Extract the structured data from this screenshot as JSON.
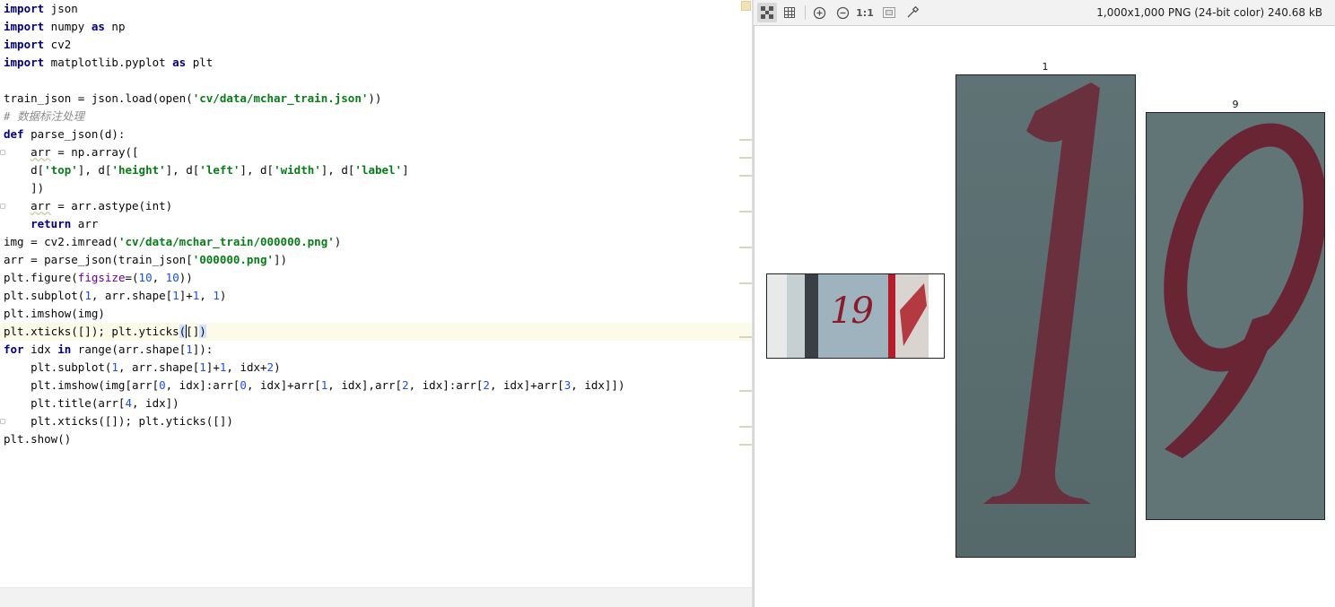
{
  "editor": {
    "lines": [
      [
        {
          "t": "import",
          "c": "kw"
        },
        {
          "t": " json"
        }
      ],
      [
        {
          "t": "import",
          "c": "kw"
        },
        {
          "t": " numpy "
        },
        {
          "t": "as",
          "c": "kw"
        },
        {
          "t": " np"
        }
      ],
      [
        {
          "t": "import",
          "c": "kw"
        },
        {
          "t": " cv2"
        }
      ],
      [
        {
          "t": "import",
          "c": "kw"
        },
        {
          "t": " matplotlib.pyplot "
        },
        {
          "t": "as",
          "c": "kw"
        },
        {
          "t": " plt"
        }
      ],
      [],
      [
        {
          "t": "train_json = json.load(open("
        },
        {
          "t": "'cv/data/mchar_train.json'",
          "c": "str"
        },
        {
          "t": "))"
        }
      ],
      [
        {
          "t": "# 数据标注处理",
          "c": "cmt"
        }
      ],
      [
        {
          "t": "def",
          "c": "kw"
        },
        {
          "t": " parse_json(d):"
        }
      ],
      [
        {
          "t": "    "
        },
        {
          "t": "arr",
          "c": "sq"
        },
        {
          "t": " = np.array(["
        }
      ],
      [
        {
          "t": "    d["
        },
        {
          "t": "'top'",
          "c": "str"
        },
        {
          "t": "], d["
        },
        {
          "t": "'height'",
          "c": "str"
        },
        {
          "t": "], d["
        },
        {
          "t": "'left'",
          "c": "str"
        },
        {
          "t": "], d["
        },
        {
          "t": "'width'",
          "c": "str"
        },
        {
          "t": "], d["
        },
        {
          "t": "'label'",
          "c": "str"
        },
        {
          "t": "]"
        }
      ],
      [
        {
          "t": "    ])"
        }
      ],
      [
        {
          "t": "    "
        },
        {
          "t": "arr",
          "c": "sq"
        },
        {
          "t": " = arr.astype(int)"
        }
      ],
      [
        {
          "t": "    "
        },
        {
          "t": "return",
          "c": "kw"
        },
        {
          "t": " arr"
        }
      ],
      [
        {
          "t": "img = cv2.imread("
        },
        {
          "t": "'cv/data/mchar_train/000000.png'",
          "c": "str"
        },
        {
          "t": ")"
        }
      ],
      [
        {
          "t": "arr = parse_json(train_json["
        },
        {
          "t": "'000000.png'",
          "c": "str"
        },
        {
          "t": "])"
        }
      ],
      [
        {
          "t": "plt.figure("
        },
        {
          "t": "figsize",
          "c": "kwarg"
        },
        {
          "t": "=("
        },
        {
          "t": "10",
          "c": "num"
        },
        {
          "t": ", "
        },
        {
          "t": "10",
          "c": "num"
        },
        {
          "t": "))"
        }
      ],
      [
        {
          "t": "plt.subplot("
        },
        {
          "t": "1",
          "c": "num"
        },
        {
          "t": ", arr.shape["
        },
        {
          "t": "1",
          "c": "num"
        },
        {
          "t": "]+"
        },
        {
          "t": "1",
          "c": "num"
        },
        {
          "t": ", "
        },
        {
          "t": "1",
          "c": "num"
        },
        {
          "t": ")"
        }
      ],
      [
        {
          "t": "plt.imshow(img)"
        }
      ],
      [
        {
          "t": "plt.xticks([]); plt.yticks"
        },
        {
          "t": "(",
          "c": "brace-hl"
        },
        {
          "t": "[]",
          "caret": true
        },
        {
          "t": ")",
          "c": "brace-hl"
        }
      ],
      [
        {
          "t": "for",
          "c": "kw"
        },
        {
          "t": " idx "
        },
        {
          "t": "in",
          "c": "kw"
        },
        {
          "t": " range(arr.shape["
        },
        {
          "t": "1",
          "c": "num"
        },
        {
          "t": "]):"
        }
      ],
      [
        {
          "t": "    plt.subplot("
        },
        {
          "t": "1",
          "c": "num"
        },
        {
          "t": ", arr.shape["
        },
        {
          "t": "1",
          "c": "num"
        },
        {
          "t": "]+"
        },
        {
          "t": "1",
          "c": "num"
        },
        {
          "t": ", idx+"
        },
        {
          "t": "2",
          "c": "num"
        },
        {
          "t": ")"
        }
      ],
      [
        {
          "t": "    plt.imshow(img[arr["
        },
        {
          "t": "0",
          "c": "num"
        },
        {
          "t": ", idx]:arr["
        },
        {
          "t": "0",
          "c": "num"
        },
        {
          "t": ", idx]+arr["
        },
        {
          "t": "1",
          "c": "num"
        },
        {
          "t": ", idx],arr["
        },
        {
          "t": "2",
          "c": "num"
        },
        {
          "t": ", idx]:arr["
        },
        {
          "t": "2",
          "c": "num"
        },
        {
          "t": ", idx]+arr["
        },
        {
          "t": "3",
          "c": "num"
        },
        {
          "t": ", idx]])"
        }
      ],
      [
        {
          "t": "    plt.title(arr["
        },
        {
          "t": "4",
          "c": "num"
        },
        {
          "t": ", idx])"
        }
      ],
      [
        {
          "t": "    plt.xticks([]); plt.yticks([])"
        }
      ],
      [
        {
          "t": "plt.show()"
        }
      ]
    ],
    "current_line": 18
  },
  "viewer": {
    "image_info": "1,000x1,000 PNG (24-bit color) 240.68 kB",
    "zoom_1to1_label": "1:1",
    "tools": [
      "checker-icon",
      "grid-icon",
      "zoom-in-icon",
      "zoom-out-icon",
      "actual-size-button",
      "fit-icon",
      "eyedropper-icon"
    ],
    "subplot_titles": [
      "1",
      "9"
    ],
    "thumb_text": "19"
  }
}
